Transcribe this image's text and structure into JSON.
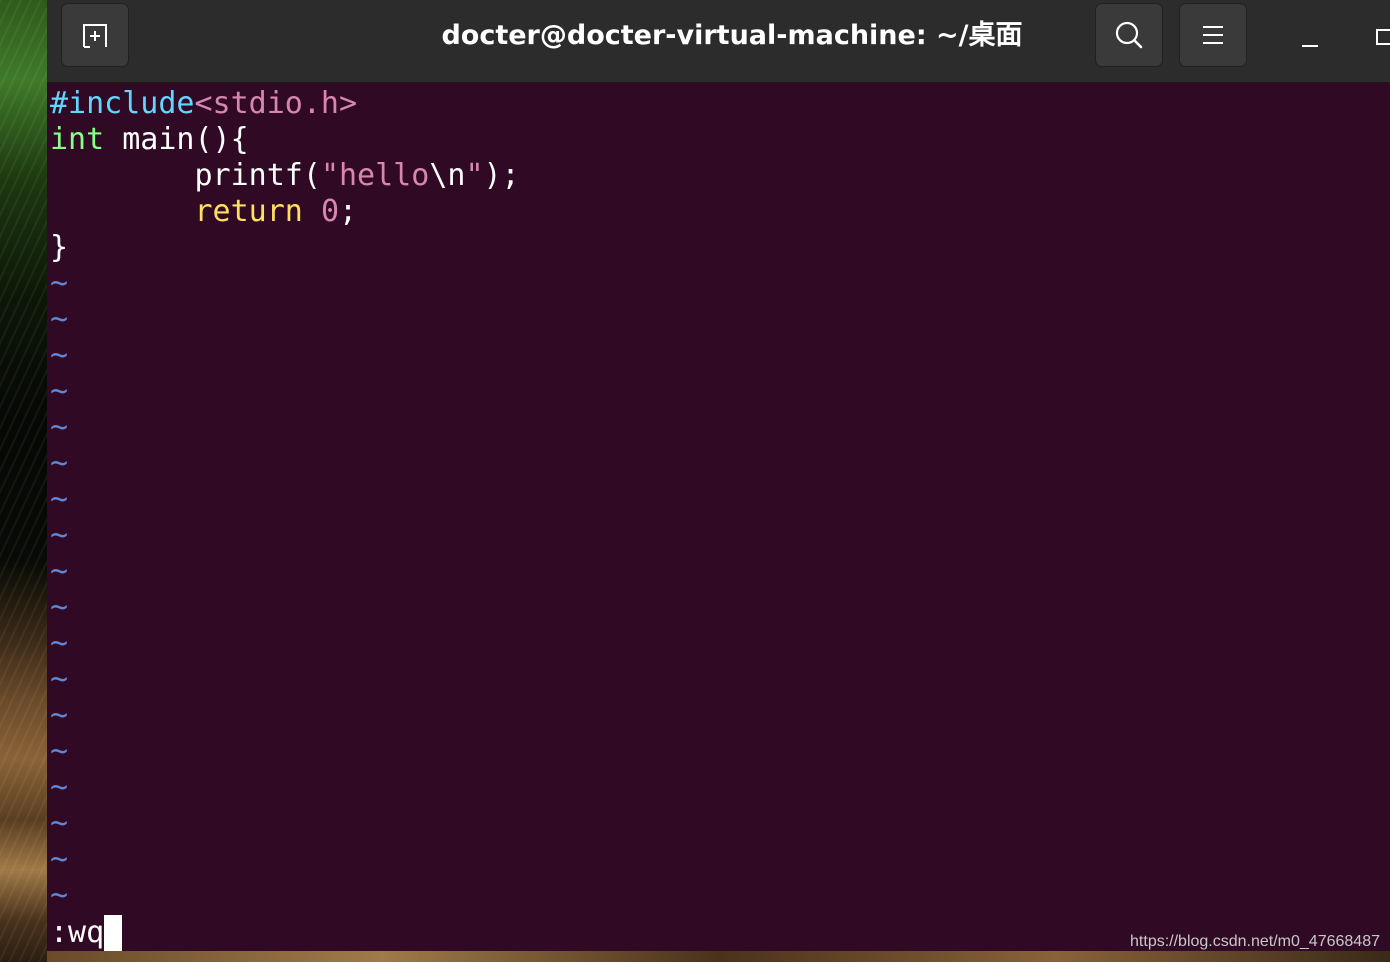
{
  "window": {
    "title": "docter@docter-virtual-machine: ~/桌面"
  },
  "headerbar": {
    "icons": [
      "new-tab-icon",
      "search-icon",
      "hamburger-menu-icon",
      "minimize-icon",
      "maximize-icon"
    ]
  },
  "editor": {
    "code": {
      "line1": {
        "directive": "#include",
        "header": "<stdio.h>"
      },
      "line2": {
        "type": "int",
        "rest": " main(){"
      },
      "line3": {
        "indent": "        ",
        "func": "printf(",
        "string_open": "\"hello",
        "escape": "\\n",
        "string_close": "\"",
        "end": ");"
      },
      "line4": {
        "indent": "        ",
        "keyword": "return",
        "space": " ",
        "number": "0",
        "end": ";"
      },
      "line5": {
        "text": "}"
      }
    },
    "empty_line_marker": "~",
    "command_line": ":wq"
  },
  "watermark": "https://blog.csdn.net/m0_47668487",
  "colors": {
    "terminal_background": "#300a24",
    "headerbar_background": "#2c2c2c",
    "preprocessor": "#5fd7ff",
    "include_path": "#d787af",
    "type_keyword": "#87ff87",
    "statement_keyword": "#ffdf5f",
    "constant": "#d787af",
    "tilde": "#5f87d7"
  }
}
